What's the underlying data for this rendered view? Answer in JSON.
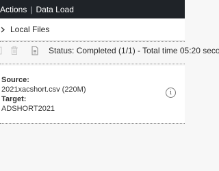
{
  "topbar": {
    "crumb_left": "Actions",
    "separator": "|",
    "crumb_right": "Data Load"
  },
  "nav": {
    "chevron_icon": "chevron-right-icon",
    "label": "Local Files"
  },
  "toolbar": {
    "icons": [
      "tool-icon",
      "trash-icon",
      "document-icon"
    ],
    "status_text": "Status: Completed (1/1) - Total time 05:20 seco"
  },
  "detail": {
    "source_label": "Source:",
    "source_value": "2021xacshort.csv (220M)",
    "target_label": "Target:",
    "target_value": "ADSHORT2021",
    "info_icon": "info-icon"
  },
  "colors": {
    "topbar_bg": "#1f2328",
    "page_bg": "#f7f7f7",
    "panel_bg": "#ffffff"
  }
}
